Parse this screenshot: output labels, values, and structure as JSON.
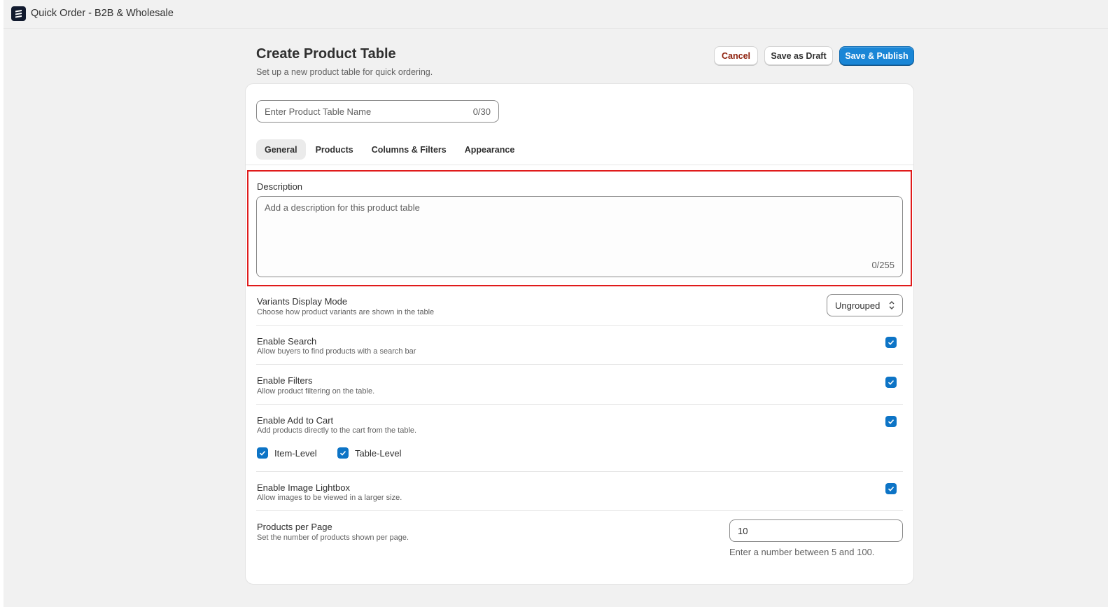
{
  "app": {
    "title": "Quick Order - B2B & Wholesale",
    "logo_icon": "stack-logo-icon"
  },
  "header": {
    "title": "Create Product Table",
    "subtitle": "Set up a new product table for quick ordering.",
    "cancel_label": "Cancel",
    "draft_label": "Save as Draft",
    "publish_label": "Save & Publish"
  },
  "name_field": {
    "placeholder": "Enter Product Table Name",
    "value": "",
    "counter": "0/30"
  },
  "tabs": [
    {
      "label": "General",
      "active": true
    },
    {
      "label": "Products",
      "active": false
    },
    {
      "label": "Columns & Filters",
      "active": false
    },
    {
      "label": "Appearance",
      "active": false
    }
  ],
  "description": {
    "label": "Description",
    "placeholder": "Add a description for this product table",
    "value": "",
    "counter": "0/255"
  },
  "settings": {
    "variants": {
      "title": "Variants Display Mode",
      "help": "Choose how product variants are shown in the table",
      "selected": "Ungrouped"
    },
    "search": {
      "title": "Enable Search",
      "help": "Allow buyers to find products with a search bar",
      "checked": true
    },
    "filters": {
      "title": "Enable Filters",
      "help": "Allow product filtering on the table.",
      "checked": true
    },
    "add_to_cart": {
      "title": "Enable Add to Cart",
      "help": "Add products directly to the cart from the table.",
      "checked": true,
      "item_level_label": "Item-Level",
      "item_level_checked": true,
      "table_level_label": "Table-Level",
      "table_level_checked": true
    },
    "lightbox": {
      "title": "Enable Image Lightbox",
      "help": "Allow images to be viewed in a larger size.",
      "checked": true
    },
    "per_page": {
      "title": "Products per Page",
      "help": "Set the number of products shown per page.",
      "value": "10",
      "hint": "Enter a number between 5 and 100."
    }
  },
  "colors": {
    "primary": "#1a86d6",
    "checkbox": "#0d74c6",
    "highlight": "#e01b1b",
    "danger_text": "#8e1f0b"
  }
}
